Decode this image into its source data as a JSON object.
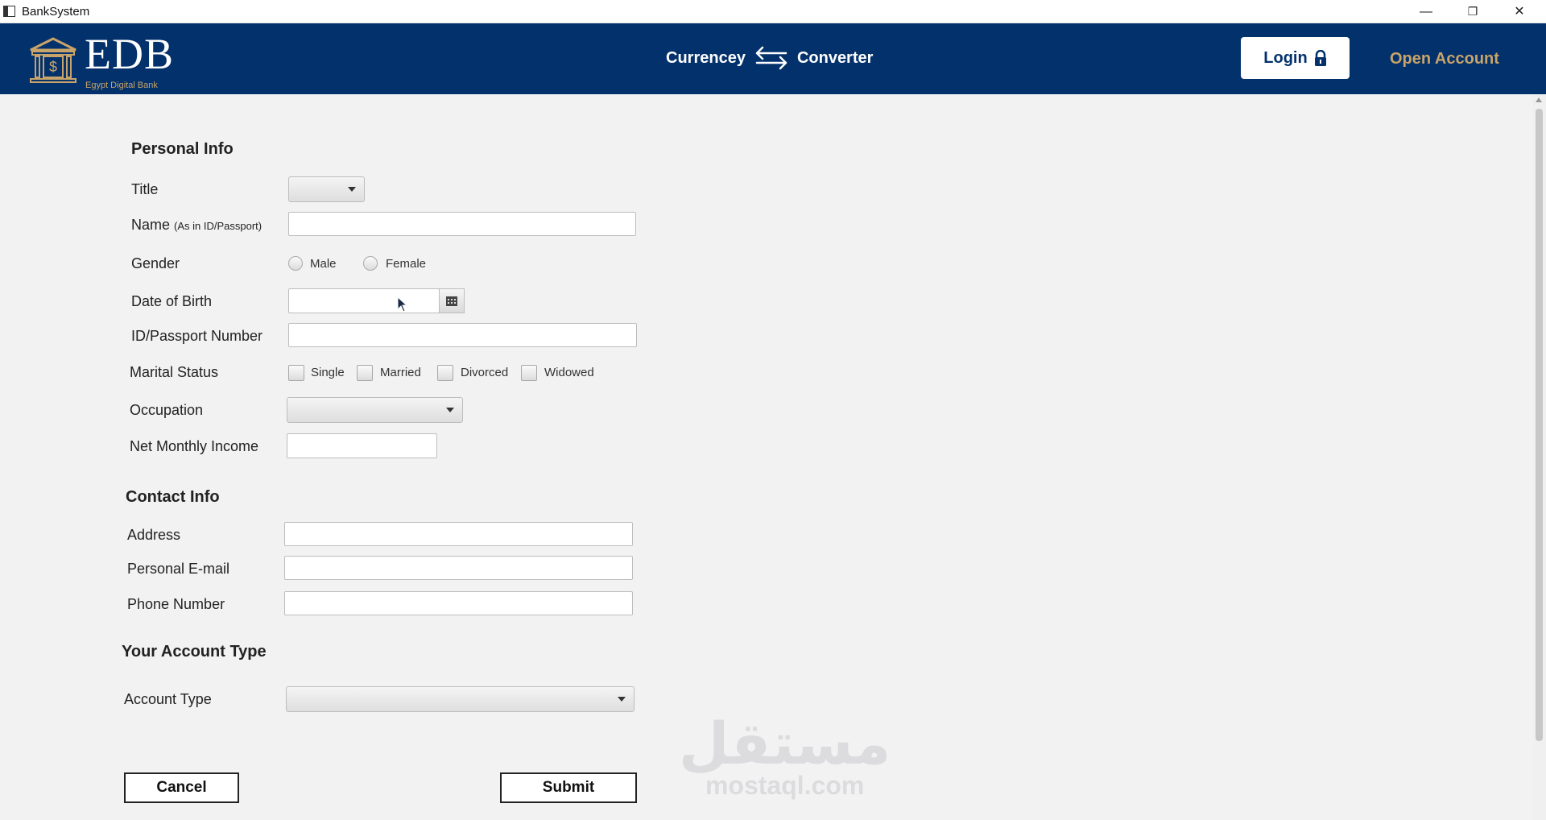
{
  "window": {
    "title": "BankSystem",
    "controls": {
      "minimize": "—",
      "maximize": "❐",
      "close": "✕"
    }
  },
  "header": {
    "logo": {
      "name": "EDB",
      "tagline": "Egypt Digital Bank"
    },
    "converter": {
      "left": "Currencey",
      "right": "Converter"
    },
    "login_label": "Login",
    "open_account_label": "Open Account",
    "colors": {
      "background": "#03316b",
      "accent": "#c9a46a"
    }
  },
  "personal_info": {
    "title": "Personal Info",
    "title_label": "Title",
    "title_value": "",
    "name_label": "Name",
    "name_hint": "(As in ID/Passport)",
    "name_value": "",
    "gender_label": "Gender",
    "gender_options": [
      "Male",
      "Female"
    ],
    "dob_label": "Date of Birth",
    "dob_value": "",
    "id_label": "ID/Passport Number",
    "id_value": "",
    "marital_label": "Marital Status",
    "marital_options": [
      "Single",
      "Married",
      "Divorced",
      "Widowed"
    ],
    "occupation_label": "Occupation",
    "occupation_value": "",
    "income_label": "Net Monthly Income",
    "income_value": ""
  },
  "contact_info": {
    "title": "Contact Info",
    "address_label": "Address",
    "address_value": "",
    "email_label": "Personal E-mail",
    "email_value": "",
    "phone_label": "Phone Number",
    "phone_value": ""
  },
  "account": {
    "title": "Your Account Type",
    "type_label": "Account Type",
    "type_value": ""
  },
  "actions": {
    "cancel": "Cancel",
    "submit": "Submit"
  },
  "watermark": {
    "arabic": "مستقل",
    "latin": "mostaql.com"
  }
}
